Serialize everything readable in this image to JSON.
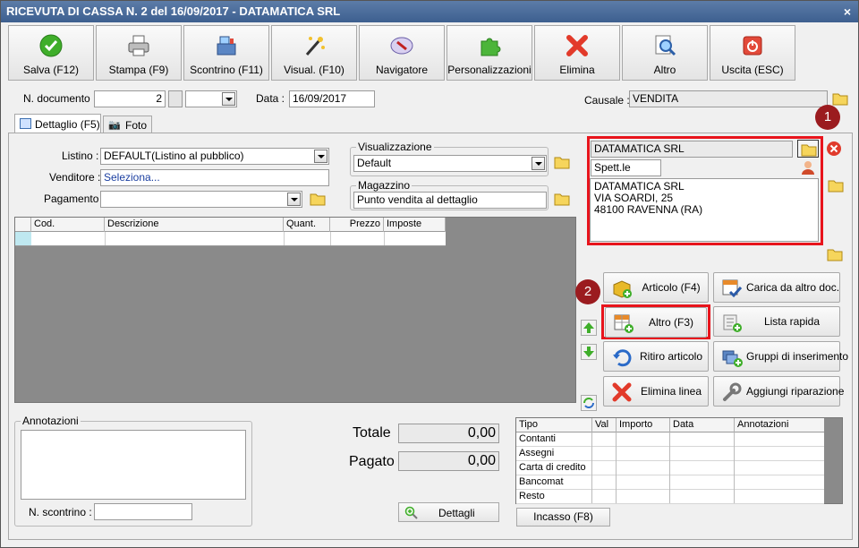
{
  "window": {
    "title": "RICEVUTA DI CASSA N. 2 del 16/09/2017 - DATAMATICA SRL",
    "close_glyph": "×"
  },
  "toolbar": {
    "buttons": [
      {
        "label": "Salva (F12)",
        "icon": "check-icon"
      },
      {
        "label": "Stampa (F9)",
        "icon": "printer-icon"
      },
      {
        "label": "Scontrino (F11)",
        "icon": "cash-register-icon"
      },
      {
        "label": "Visual. (F10)",
        "icon": "magic-wand-icon"
      },
      {
        "label": "Navigatore",
        "icon": "compass-icon"
      },
      {
        "label": "Personalizzazioni",
        "icon": "puzzle-icon"
      },
      {
        "label": "Elimina",
        "icon": "delete-x-icon"
      },
      {
        "label": "Altro",
        "icon": "magnifier-icon"
      },
      {
        "label": "Uscita (ESC)",
        "icon": "power-icon"
      }
    ]
  },
  "header": {
    "n_documento_label": "N. documento :",
    "n_documento_value": "2",
    "data_label": "Data :",
    "data_value": "16/09/2017",
    "causale_label": "Causale :",
    "causale_value": "VENDITA"
  },
  "tabs": [
    {
      "label": "Dettaglio (F5)"
    },
    {
      "label": "Foto"
    }
  ],
  "form": {
    "listino_label": "Listino :",
    "listino_value": "DEFAULT(Listino al pubblico)",
    "venditore_label": "Venditore :",
    "venditore_value": "Seleziona...",
    "pagamento_label": "Pagamento :",
    "pagamento_value": "",
    "visualizzazione_title": "Visualizzazione",
    "visualizzazione_value": "Default",
    "magazzino_title": "Magazzino",
    "magazzino_value": "Punto vendita al dettaglio"
  },
  "customer": {
    "name": "DATAMATICA SRL",
    "salutation": "Spett.le",
    "address_lines": [
      "DATAMATICA SRL",
      "VIA SOARDI, 25",
      "48100 RAVENNA (RA)"
    ]
  },
  "grid": {
    "columns": [
      "Cod.",
      "Descrizione",
      "Quant.",
      "Prezzo",
      "Imposte"
    ]
  },
  "actions": [
    {
      "label": "Articolo (F4)",
      "icon": "box-add-icon"
    },
    {
      "label": "Carica da altro doc.",
      "icon": "grid-check-icon"
    },
    {
      "label": "Altro (F3)",
      "icon": "grid-add-icon"
    },
    {
      "label": "Lista rapida",
      "icon": "list-add-icon"
    },
    {
      "label": "Ritiro articolo",
      "icon": "undo-arrow-icon"
    },
    {
      "label": "Gruppi di inserimento",
      "icon": "group-add-icon"
    },
    {
      "label": "Elimina linea",
      "icon": "delete-x-icon"
    },
    {
      "label": "Aggiungi riparazione",
      "icon": "wrench-icon"
    }
  ],
  "callouts": [
    "1",
    "2"
  ],
  "annotazioni": {
    "title": "Annotazioni",
    "value": ""
  },
  "scontrino": {
    "label": "N. scontrino :",
    "value": ""
  },
  "totals": {
    "totale_label": "Totale",
    "totale_value": "0,00",
    "pagato_label": "Pagato",
    "pagato_value": "0,00",
    "dettagli_label": "Dettagli"
  },
  "payments": {
    "columns": [
      "Tipo",
      "Val",
      "Importo",
      "Data",
      "Annotazioni"
    ],
    "rows": [
      "Contanti",
      "Assegni",
      "Carta di credito",
      "Bancomat",
      "Resto"
    ],
    "incasso_label": "Incasso (F8)"
  }
}
